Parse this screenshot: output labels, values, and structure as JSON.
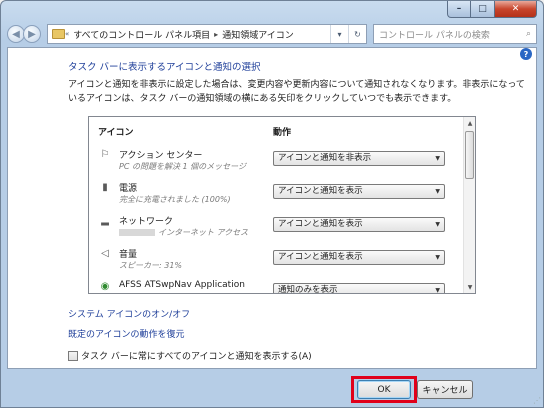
{
  "window": {
    "controls": {
      "minimize": "–",
      "maximize": "□",
      "close": "✕"
    }
  },
  "address": {
    "history_glyph": "«",
    "crumbs": [
      "すべてのコントロール パネル項目",
      "通知領域アイコン"
    ],
    "separator": "▸",
    "dropdown_glyph": "▾",
    "refresh_glyph": "↻",
    "back_glyph": "◀",
    "forward_glyph": "▶"
  },
  "search": {
    "placeholder": "コントロール パネルの検索",
    "icon_glyph": "⌕"
  },
  "help_glyph": "?",
  "page": {
    "title": "タスク バーに表示するアイコンと通知の選択",
    "description": "アイコンと通知を非表示に設定した場合は、変更内容や更新内容について通知されなくなります。非表示になっているアイコンは、タスク バーの通知領域の横にある矢印をクリックしていつでも表示できます。"
  },
  "list": {
    "header_icon": "アイコン",
    "header_action": "動作",
    "rows": [
      {
        "icon": "flag-icon",
        "glyph": "⚐",
        "name": "アクション センター",
        "sub": "PC の問題を解決 1 個のメッセージ",
        "action": "アイコンと通知を非表示"
      },
      {
        "icon": "battery-icon",
        "glyph": "▮",
        "name": "電源",
        "sub": "完全に充電されました (100%)",
        "action": "アイコンと通知を表示"
      },
      {
        "icon": "network-icon",
        "glyph": "▂",
        "name": "ネットワーク",
        "sub": "インターネット アクセス",
        "action": "アイコンと通知を表示"
      },
      {
        "icon": "speaker-icon",
        "glyph": "◁",
        "name": "音量",
        "sub": "スピーカー: 31%",
        "action": "アイコンと通知を表示"
      },
      {
        "icon": "app-icon",
        "glyph": "◉",
        "name": "AFSS ATSwpNav Application",
        "sub": "",
        "action": "通知のみを表示"
      }
    ],
    "scroll_up_glyph": "▲",
    "scroll_down_glyph": "▼",
    "dropdown_glyph": "▼"
  },
  "links": {
    "system_icons": "システム アイコンのオン/オフ",
    "restore_default": "既定のアイコンの動作を復元"
  },
  "checkbox": {
    "label": "タスク バーに常にすべてのアイコンと通知を表示する(A)",
    "checked": false
  },
  "buttons": {
    "ok": "OK",
    "cancel": "キャンセル"
  },
  "colors": {
    "link": "#1f3f9a",
    "highlight": "#e0001a",
    "window_frame": "#b6cde6"
  }
}
